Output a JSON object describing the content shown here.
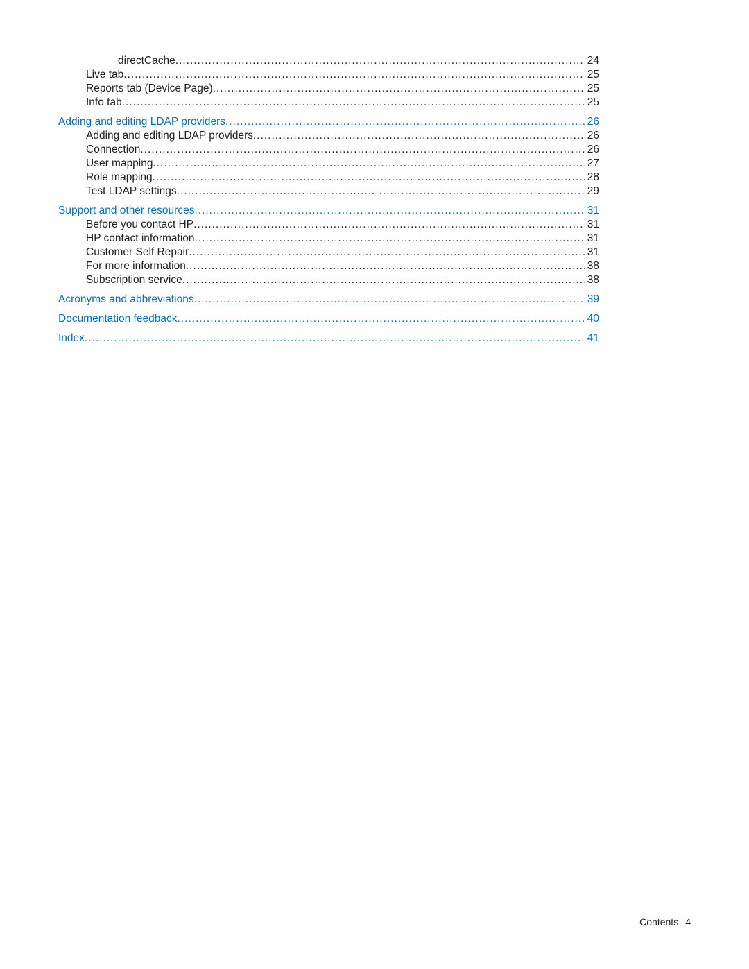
{
  "toc": [
    {
      "label": "directCache",
      "page": "24",
      "indent": 2,
      "link": false,
      "gap": false
    },
    {
      "label": "Live tab",
      "page": "25",
      "indent": 1,
      "link": false,
      "gap": false
    },
    {
      "label": "Reports tab (Device Page)",
      "page": "25",
      "indent": 1,
      "link": false,
      "gap": false
    },
    {
      "label": "Info tab",
      "page": "25",
      "indent": 1,
      "link": false,
      "gap": false
    },
    {
      "label": "Adding and editing LDAP providers",
      "page": "26",
      "indent": 0,
      "link": true,
      "gap": true
    },
    {
      "label": "Adding and editing LDAP providers",
      "page": "26",
      "indent": 1,
      "link": false,
      "gap": false
    },
    {
      "label": "Connection",
      "page": "26",
      "indent": 1,
      "link": false,
      "gap": false
    },
    {
      "label": "User mapping",
      "page": "27",
      "indent": 1,
      "link": false,
      "gap": false
    },
    {
      "label": "Role mapping",
      "page": "28",
      "indent": 1,
      "link": false,
      "gap": false
    },
    {
      "label": "Test LDAP settings",
      "page": "29",
      "indent": 1,
      "link": false,
      "gap": false
    },
    {
      "label": "Support and other resources",
      "page": "31",
      "indent": 0,
      "link": true,
      "gap": true
    },
    {
      "label": "Before you contact HP",
      "page": "31",
      "indent": 1,
      "link": false,
      "gap": false
    },
    {
      "label": "HP contact information",
      "page": "31",
      "indent": 1,
      "link": false,
      "gap": false
    },
    {
      "label": "Customer Self Repair",
      "page": "31",
      "indent": 1,
      "link": false,
      "gap": false
    },
    {
      "label": "For more information",
      "page": "38",
      "indent": 1,
      "link": false,
      "gap": false
    },
    {
      "label": "Subscription service",
      "page": "38",
      "indent": 1,
      "link": false,
      "gap": false
    },
    {
      "label": "Acronyms and abbreviations",
      "page": "39",
      "indent": 0,
      "link": true,
      "gap": true
    },
    {
      "label": "Documentation feedback",
      "page": "40",
      "indent": 0,
      "link": true,
      "gap": true
    },
    {
      "label": "Index",
      "page": "41",
      "indent": 0,
      "link": true,
      "gap": true
    }
  ],
  "footer": {
    "label": "Contents",
    "page": "4"
  }
}
